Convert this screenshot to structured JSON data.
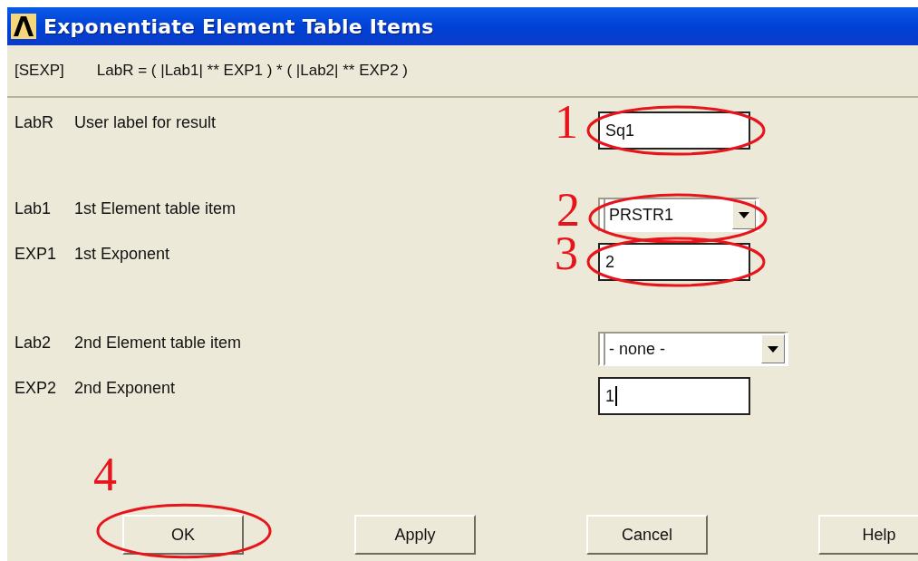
{
  "window": {
    "title": "Exponentiate Element Table Items"
  },
  "command": {
    "tag": "[SEXP]",
    "formula": "LabR = ( |Lab1| ** EXP1 ) * ( |Lab2| ** EXP2 )"
  },
  "fields": [
    {
      "code": "LabR",
      "label": "User label for result",
      "kind": "text",
      "value": "Sq1",
      "focused": false,
      "annotation": "1"
    },
    {
      "code": "Lab1",
      "label": "1st Element table item",
      "kind": "dropdown",
      "value": "PRSTR1",
      "annotation": "2"
    },
    {
      "code": "EXP1",
      "label": "1st Exponent",
      "kind": "text",
      "value": "2",
      "focused": false,
      "annotation": "3"
    },
    {
      "code": "Lab2",
      "label": "2nd Element table item",
      "kind": "dropdown",
      "value": "- none -"
    },
    {
      "code": "EXP2",
      "label": "2nd Exponent",
      "kind": "text",
      "value": "1",
      "focused": true
    }
  ],
  "buttons": [
    {
      "label": "OK",
      "annotation": "4"
    },
    {
      "label": "Apply"
    },
    {
      "label": "Cancel"
    },
    {
      "label": "Help"
    }
  ]
}
